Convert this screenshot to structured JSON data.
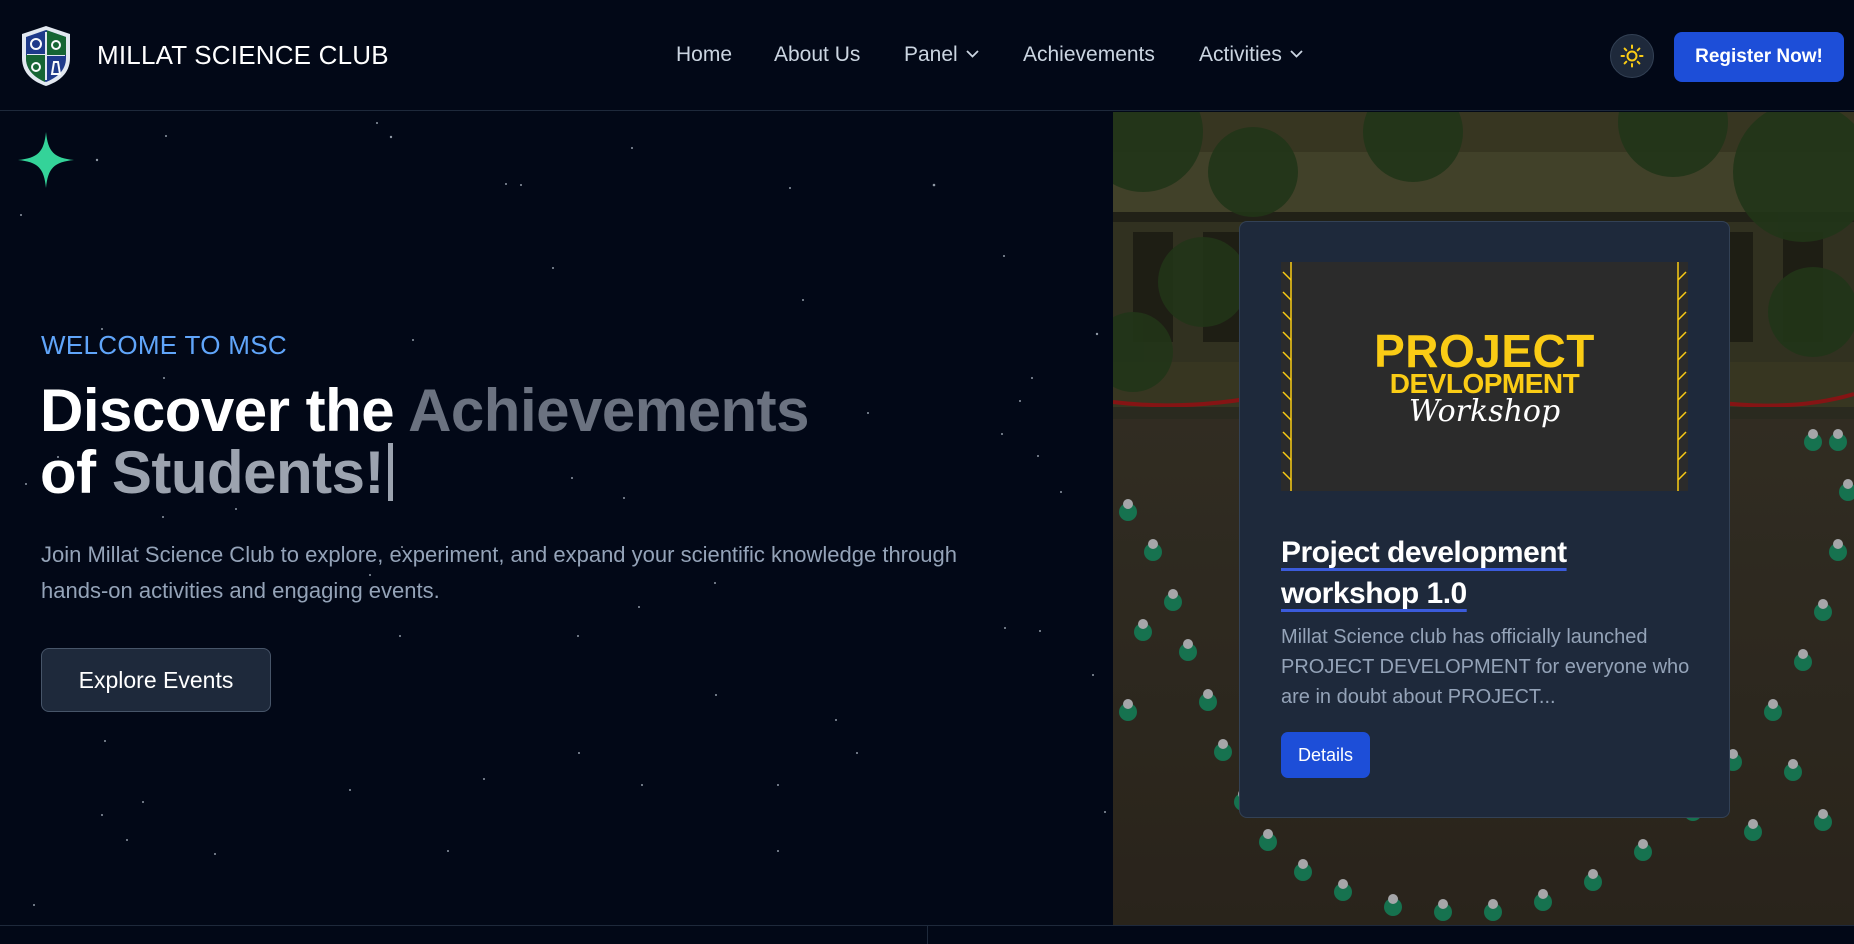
{
  "brand": {
    "name": "MILLAT SCIENCE CLUB"
  },
  "nav": {
    "items": [
      {
        "label": "Home"
      },
      {
        "label": "About Us"
      },
      {
        "label": "Panel"
      },
      {
        "label": "Achievements"
      },
      {
        "label": "Activities"
      }
    ],
    "register_label": "Register Now!"
  },
  "hero": {
    "eyebrow": "WELCOME TO MSC",
    "title_part1": "Discover the ",
    "title_part2": "Achievements",
    "title_part3": "of ",
    "title_part4": "Students!",
    "subtitle": "Join Millat Science Club to explore, experiment, and expand your scientific knowledge through hands-on activities and engaging events.",
    "cta_label": "Explore Events"
  },
  "card": {
    "image_text_line1": "PROJECT",
    "image_text_line2": "DEVLOPMENT",
    "image_text_line3": "Workshop",
    "title": "Project development workshop 1.0",
    "description": "Millat Science club has officially launched PROJECT DEVELOPMENT for everyone who are in doubt about PROJECT...",
    "button_label": "Details"
  },
  "colors": {
    "background": "#020817",
    "accent": "#1d4ed8",
    "eyebrow": "#60a5fa",
    "card": "#1e293b",
    "thumb_text": "#facc15"
  },
  "icons": {
    "logo": "shield-crest-icon",
    "theme": "sun-icon",
    "dropdown": "chevron-down-icon",
    "sparkle": "sparkle-icon"
  }
}
